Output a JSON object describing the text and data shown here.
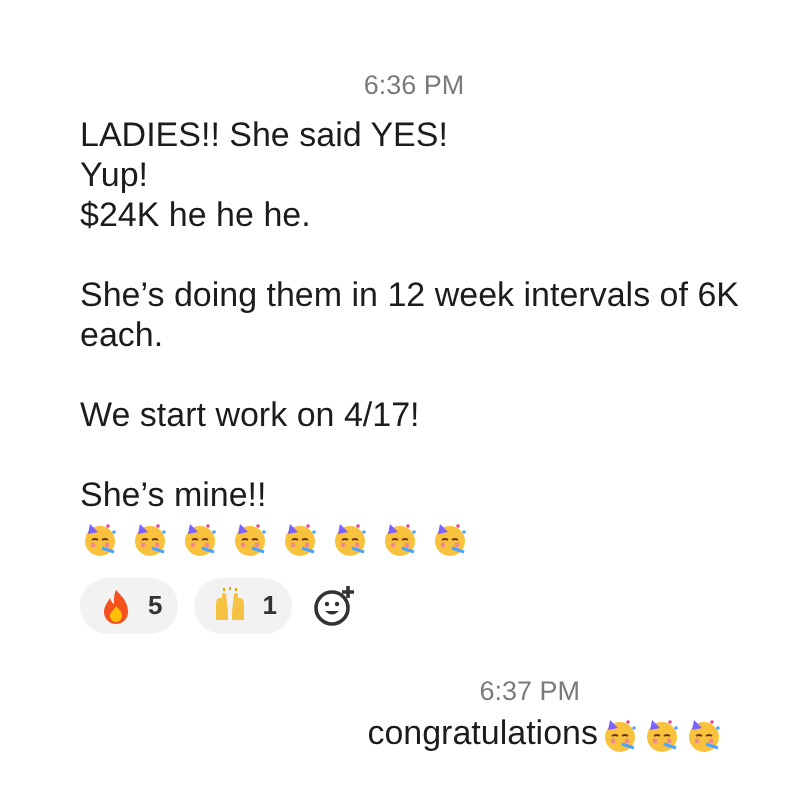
{
  "messages": [
    {
      "time": "6:36 PM",
      "kind": "received",
      "paragraphs": [
        [
          "LADIES!! She said YES!",
          "Yup!",
          "$24K he he he."
        ],
        [
          "She’s doing them in 12 week intervals of 6K each."
        ],
        [
          "We start work on 4/17!"
        ],
        [
          "She’s mine!!"
        ]
      ],
      "emojis": [
        {
          "kind": "party-face"
        },
        {
          "kind": "party-face"
        },
        {
          "kind": "party-face"
        },
        {
          "kind": "party-face"
        },
        {
          "kind": "party-face"
        },
        {
          "kind": "party-face"
        },
        {
          "kind": "party-face"
        },
        {
          "kind": "party-face"
        }
      ],
      "reactions": [
        {
          "kind": "fire",
          "count": "5"
        },
        {
          "kind": "raised-hands",
          "count": "1"
        }
      ],
      "add_reaction": true
    },
    {
      "time": "6:37 PM",
      "kind": "sent",
      "text": "congratulations",
      "emojis": [
        {
          "kind": "party-face"
        },
        {
          "kind": "party-face"
        },
        {
          "kind": "party-face"
        }
      ]
    }
  ]
}
